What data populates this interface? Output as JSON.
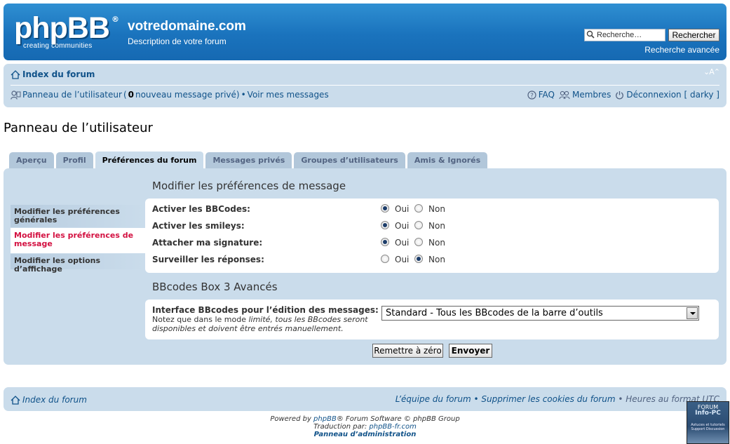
{
  "header": {
    "logo_text": "phpBB",
    "logo_reg": "®",
    "logo_tagline": "creating   communities",
    "site_title": "votredomaine.com",
    "site_description": "Description de votre forum",
    "search_placeholder": "Recherche…",
    "search_button": "Rechercher",
    "advanced_search": "Recherche avancée"
  },
  "navbar": {
    "forum_index": "Index du forum",
    "font_size_control": "⌄A⌃",
    "ucp_link": "Panneau de l’utilisateur",
    "pm_open": " (",
    "pm_count": "0",
    "pm_text": " nouveau message privé)",
    "bullet": " • ",
    "view_messages": "Voir mes messages",
    "faq": "FAQ",
    "members": "Membres",
    "logout": "Déconnexion [ darky ]"
  },
  "page_title": "Panneau de l’utilisateur",
  "tabs": [
    {
      "label": "Aperçu"
    },
    {
      "label": "Profil"
    },
    {
      "label": "Préférences du forum"
    },
    {
      "label": "Messages privés"
    },
    {
      "label": "Groupes d’utilisateurs"
    },
    {
      "label": "Amis & Ignorés"
    }
  ],
  "active_tab": "Préférences du forum",
  "sidemenu": [
    {
      "label": "Modifier les préférences générales"
    },
    {
      "label": "Modifier les préférences de message"
    },
    {
      "label": "Modifier les options d’affichage"
    }
  ],
  "section1_title": "Modifier les préférences de message",
  "options": [
    {
      "label": "Activer les BBCodes:",
      "yes": "Oui",
      "no": "Non",
      "value": "Oui"
    },
    {
      "label": "Activer les smileys:",
      "yes": "Oui",
      "no": "Non",
      "value": "Oui"
    },
    {
      "label": "Attacher ma signature:",
      "yes": "Oui",
      "no": "Non",
      "value": "Oui"
    },
    {
      "label": "Surveiller les réponses:",
      "yes": "Oui",
      "no": "Non",
      "value": "Non"
    }
  ],
  "section2_title": "BBcodes Box 3 Avancés",
  "bbcodes": {
    "label": "Interface BBcodes pour l’édition des messages:",
    "note_1": "Notez que dans le mode ",
    "note_em": "limité",
    "note_2": ", tous les BBcodes seront disponibles et doivent être entrés manuellement.",
    "selected": "Standard - Tous les BBcodes de la barre d’outils"
  },
  "buttons": {
    "reset": "Remettre à zéro",
    "submit": "Envoyer"
  },
  "footer": {
    "forum_index": "Index du forum",
    "team": "L’équipe du forum",
    "bullet": " • ",
    "delete_cookies": "Supprimer les cookies du forum",
    "timezone": "Heures au format UTC",
    "powered_by": "Powered by ",
    "phpbb": "phpBB",
    "powered_rest": "® Forum Software © phpBB Group",
    "translation": "Traduction par: ",
    "translator": "phpBB-fr.com",
    "admin_panel": "Panneau d’administration"
  },
  "badge": {
    "line1": "FORUM",
    "line2": "Info-PC",
    "line3": "Astuces et tutoriels Support Discussion"
  },
  "colors": {
    "header_blue": "#1a73bd",
    "panel_bg": "#cadceb",
    "link": "#105289",
    "active_menu": "#d31141"
  }
}
